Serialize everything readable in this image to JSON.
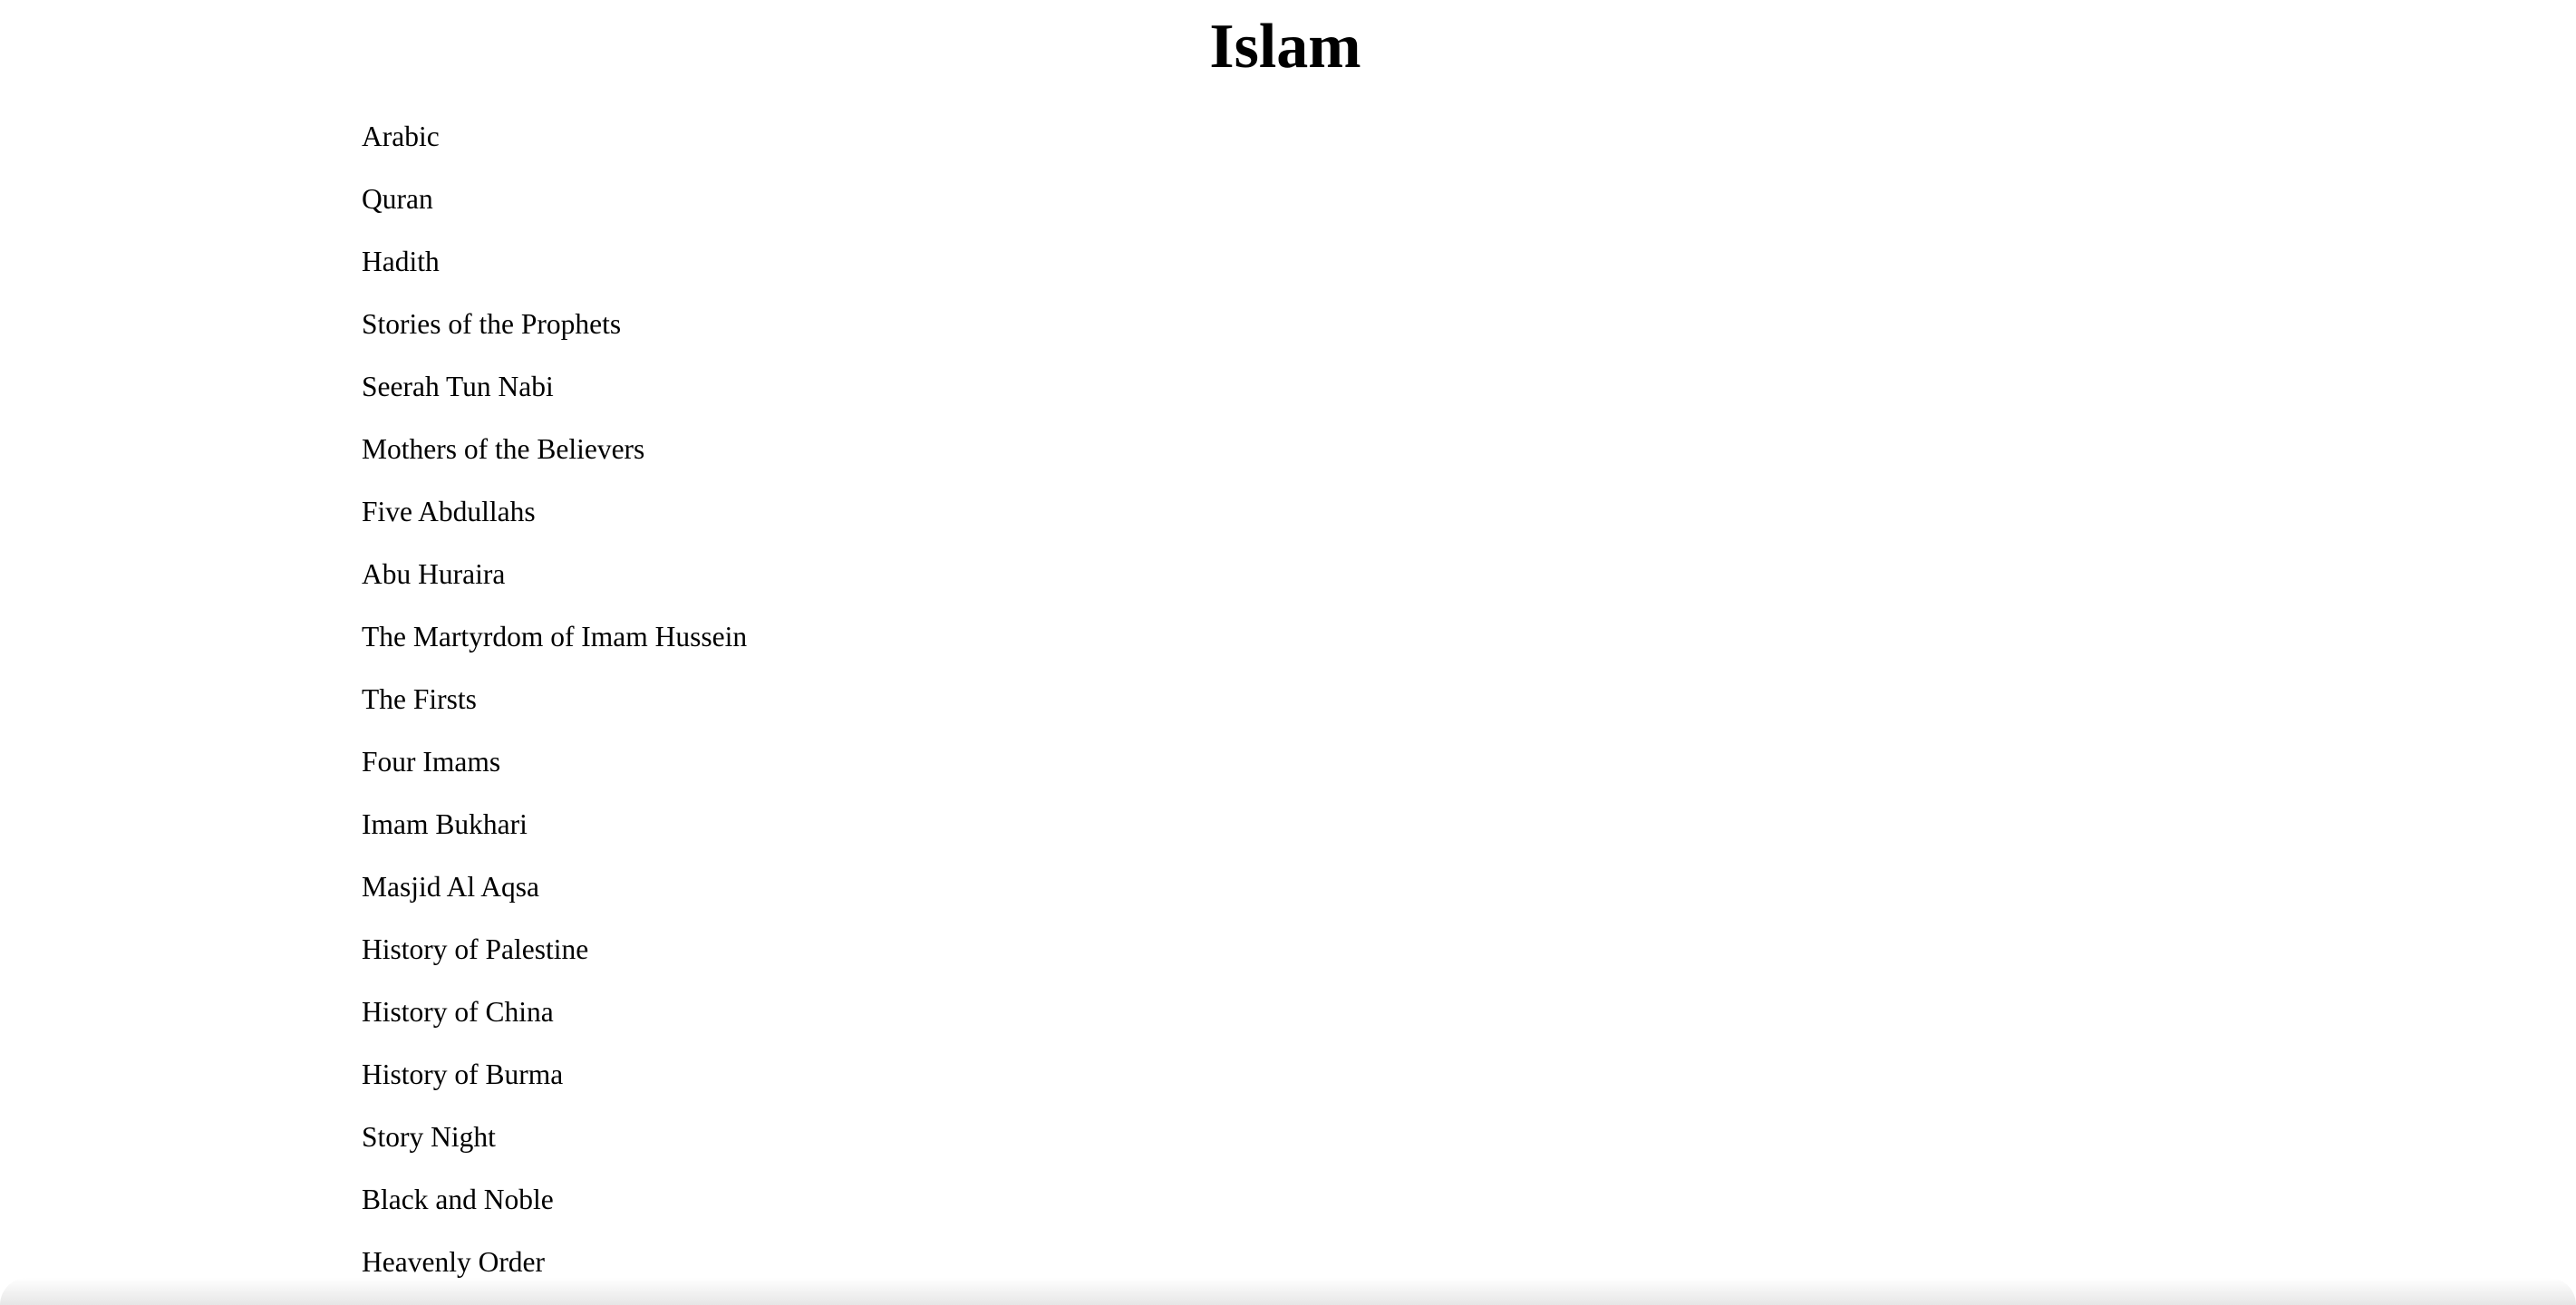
{
  "page": {
    "title": "Islam"
  },
  "topics": [
    {
      "label": "Arabic"
    },
    {
      "label": "Quran"
    },
    {
      "label": "Hadith"
    },
    {
      "label": "Stories of the Prophets"
    },
    {
      "label": "Seerah Tun Nabi"
    },
    {
      "label": "Mothers of the Believers"
    },
    {
      "label": "Five Abdullahs"
    },
    {
      "label": "Abu Huraira"
    },
    {
      "label": "The Martyrdom of Imam Hussein"
    },
    {
      "label": "The Firsts"
    },
    {
      "label": "Four Imams"
    },
    {
      "label": "Imam Bukhari"
    },
    {
      "label": "Masjid Al Aqsa"
    },
    {
      "label": "History of Palestine"
    },
    {
      "label": "History of China"
    },
    {
      "label": "History of Burma"
    },
    {
      "label": "Story Night"
    },
    {
      "label": "Black and Noble"
    },
    {
      "label": "Heavenly Order"
    }
  ]
}
